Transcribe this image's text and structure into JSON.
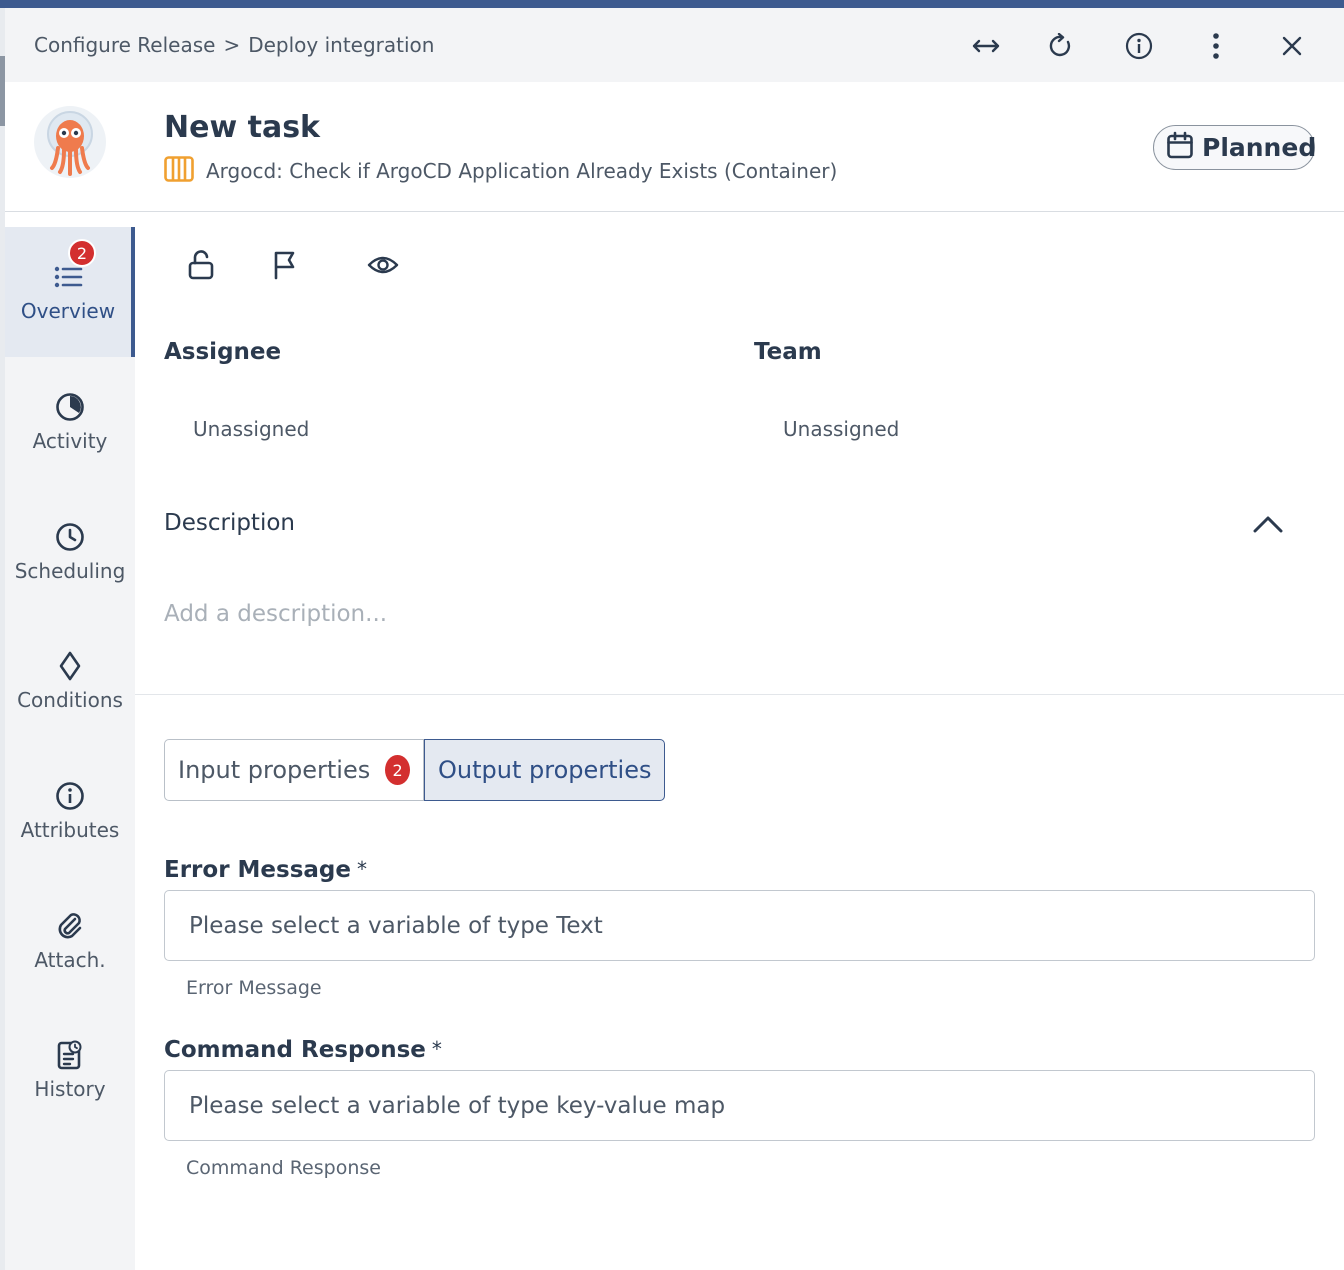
{
  "breadcrumb": {
    "parent": "Configure Release",
    "separator": ">",
    "current": "Deploy integration"
  },
  "toolbar": {
    "icons": [
      "expand-horizontal-icon",
      "refresh-icon",
      "info-icon",
      "more-vertical-icon",
      "close-icon"
    ]
  },
  "task": {
    "title": "New task",
    "type_label": "Argocd: Check if ArgoCD Application Already Exists (Container)",
    "status": "Planned"
  },
  "sidenav": {
    "items": [
      {
        "label": "Overview",
        "badge": "2",
        "active": true
      },
      {
        "label": "Activity"
      },
      {
        "label": "Scheduling"
      },
      {
        "label": "Conditions"
      },
      {
        "label": "Attributes"
      },
      {
        "label": "Attach."
      },
      {
        "label": "History"
      }
    ]
  },
  "overview": {
    "assignee_label": "Assignee",
    "assignee_value": "Unassigned",
    "team_label": "Team",
    "team_value": "Unassigned",
    "description_label": "Description",
    "description_placeholder": "Add a description..."
  },
  "tabs": {
    "input_label": "Input properties",
    "input_badge": "2",
    "output_label": "Output properties"
  },
  "properties": [
    {
      "label": "Error Message",
      "required": "*",
      "placeholder": "Please select a variable of type Text",
      "help": "Error Message"
    },
    {
      "label": "Command Response",
      "required": "*",
      "placeholder": "Please select a variable of type key-value map",
      "help": "Command Response"
    }
  ],
  "colors": {
    "accent": "#3d5a8f",
    "badge": "#d32f2f",
    "type_icon": "#f0a030"
  }
}
